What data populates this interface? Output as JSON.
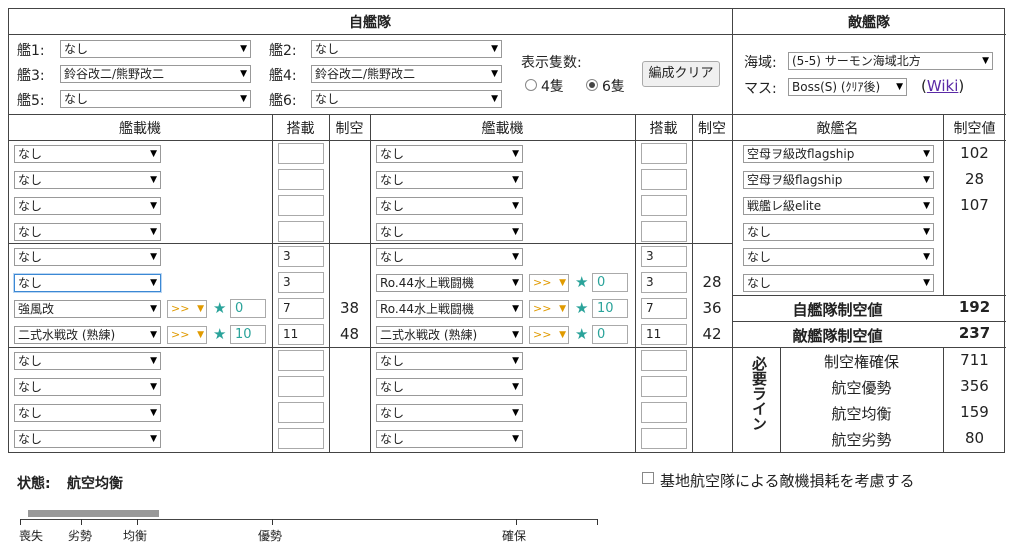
{
  "own_fleet": {
    "title": "自艦隊",
    "ship_labels": [
      "艦1:",
      "艦2:",
      "艦3:",
      "艦4:",
      "艦5:",
      "艦6:"
    ],
    "ships": [
      "なし",
      "なし",
      "鈴谷改二/熊野改二",
      "鈴谷改二/熊野改二",
      "なし",
      "なし"
    ],
    "display_count_label": "表示隻数:",
    "count_options": [
      "4隻",
      "6隻"
    ],
    "count_selected": "6隻",
    "clear_button": "編成クリア"
  },
  "enemy_fleet": {
    "title": "敵艦隊",
    "area_label": "海域:",
    "area_value": "(5-5) サーモン海域北方",
    "node_label": "マス:",
    "node_value": "Boss(S) (ｸﾘｱ後)",
    "wiki_open": "(",
    "wiki_link": "Wiki",
    "wiki_close": ")"
  },
  "equip_table": {
    "headers": {
      "equip": "艦載機",
      "slots": "搭載",
      "air": "制空"
    },
    "left": [
      {
        "name": "なし",
        "slots": "",
        "air": ""
      },
      {
        "name": "なし",
        "slots": "",
        "air": ""
      },
      {
        "name": "なし",
        "slots": "",
        "air": ""
      },
      {
        "name": "なし",
        "slots": "",
        "air": ""
      },
      {
        "name": "なし",
        "slots": "3",
        "air": ""
      },
      {
        "name": "なし",
        "slots": "3",
        "air": ""
      },
      {
        "name": "強風改",
        "prof": ">>",
        "improve": "0",
        "slots": "7",
        "air": "38"
      },
      {
        "name": "二式水戦改 (熟練)",
        "prof": ">>",
        "improve": "10",
        "slots": "11",
        "air": "48"
      },
      {
        "name": "なし",
        "slots": "",
        "air": ""
      },
      {
        "name": "なし",
        "slots": "",
        "air": ""
      },
      {
        "name": "なし",
        "slots": "",
        "air": ""
      },
      {
        "name": "なし",
        "slots": "",
        "air": ""
      }
    ],
    "right": [
      {
        "name": "なし",
        "slots": "",
        "air": ""
      },
      {
        "name": "なし",
        "slots": "",
        "air": ""
      },
      {
        "name": "なし",
        "slots": "",
        "air": ""
      },
      {
        "name": "なし",
        "slots": "",
        "air": ""
      },
      {
        "name": "なし",
        "slots": "3",
        "air": ""
      },
      {
        "name": "Ro.44水上戦闘機",
        "prof": ">>",
        "improve": "0",
        "slots": "3",
        "air": "28"
      },
      {
        "name": "Ro.44水上戦闘機",
        "prof": ">>",
        "improve": "10",
        "slots": "7",
        "air": "36"
      },
      {
        "name": "二式水戦改 (熟練)",
        "prof": ">>",
        "improve": "0",
        "slots": "11",
        "air": "42"
      },
      {
        "name": "なし",
        "slots": "",
        "air": ""
      },
      {
        "name": "なし",
        "slots": "",
        "air": ""
      },
      {
        "name": "なし",
        "slots": "",
        "air": ""
      },
      {
        "name": "なし",
        "slots": "",
        "air": ""
      }
    ]
  },
  "enemy_table": {
    "headers": {
      "name": "敵艦名",
      "air": "制空値"
    },
    "rows": [
      {
        "name": "空母ヲ級改flagship",
        "air": "102"
      },
      {
        "name": "空母ヲ級flagship",
        "air": "28"
      },
      {
        "name": "戦艦レ級elite",
        "air": "107"
      },
      {
        "name": "なし",
        "air": ""
      },
      {
        "name": "なし",
        "air": ""
      },
      {
        "name": "なし",
        "air": ""
      }
    ],
    "own_total_label": "自艦隊制空値",
    "own_total": "192",
    "enemy_total_label": "敵艦隊制空値",
    "enemy_total": "237",
    "required_label": "必要ライン",
    "thresholds": [
      {
        "label": "制空権確保",
        "value": "711"
      },
      {
        "label": "航空優勢",
        "value": "356"
      },
      {
        "label": "航空均衡",
        "value": "159"
      },
      {
        "label": "航空劣勢",
        "value": "80"
      }
    ]
  },
  "status": {
    "label": "状態:",
    "value": "航空均衡",
    "base_air_label": "基地航空隊による敵機損耗を考慮する",
    "gauge_ticks": [
      "喪失",
      "劣勢",
      "均衡",
      "優勢",
      "確保"
    ],
    "gauge_value_ratio": 0.81
  }
}
